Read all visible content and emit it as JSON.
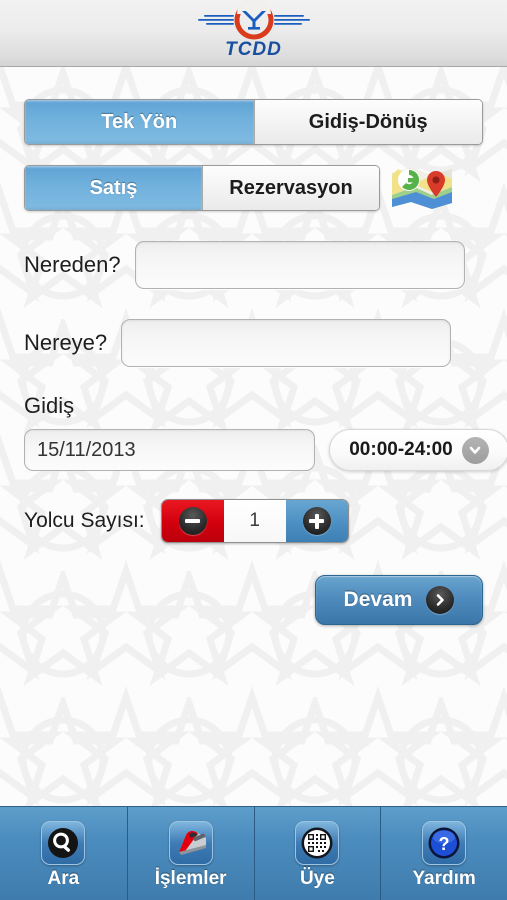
{
  "header": {
    "logo_name": "tcdd-logo",
    "logo_text": "TCDD",
    "logo_star_color": "#e03020",
    "logo_crescent_color": "#d93b1c",
    "logo_wing_color": "#1a5fbf",
    "logo_text_color": "#1a4fa0"
  },
  "trip_type": {
    "name": "trip-type-segmented-control",
    "options": [
      {
        "label": "Tek Yön",
        "active": true
      },
      {
        "label": "Gidiş-Dönüş",
        "active": false
      }
    ]
  },
  "purchase_type": {
    "name": "purchase-type-segmented-control",
    "options": [
      {
        "label": "Satış",
        "active": true
      },
      {
        "label": "Rezervasyon",
        "active": false
      }
    ],
    "map_icon_name": "map-icon"
  },
  "form": {
    "from": {
      "label": "Nereden?",
      "value": "",
      "placeholder": ""
    },
    "to": {
      "label": "Nereye?",
      "value": "",
      "placeholder": ""
    },
    "departure": {
      "label": "Gidiş",
      "date_value": "15/11/2013",
      "date_placeholder": "",
      "time_value": "00:00-24:00"
    },
    "passengers": {
      "label": "Yolcu Sayısı:",
      "count": "1",
      "decrement_icon": "minus-icon",
      "increment_icon": "plus-icon"
    },
    "submit": {
      "label": "Devam",
      "icon": "chevron-right-icon"
    }
  },
  "tabbar": {
    "items": [
      {
        "label": "Ara",
        "icon": "search-icon",
        "active": true
      },
      {
        "label": "İşlemler",
        "icon": "train-icon",
        "active": false
      },
      {
        "label": "Üye",
        "icon": "qr-code-icon",
        "active": false
      },
      {
        "label": "Yardım",
        "icon": "question-mark-icon",
        "active": false
      }
    ]
  },
  "colors": {
    "accent_blue": "#4f8cbd",
    "active_segment_blue": "#6fb0dc",
    "minus_red": "#d2000d",
    "tabbar_blue": "#4b8cbe"
  }
}
